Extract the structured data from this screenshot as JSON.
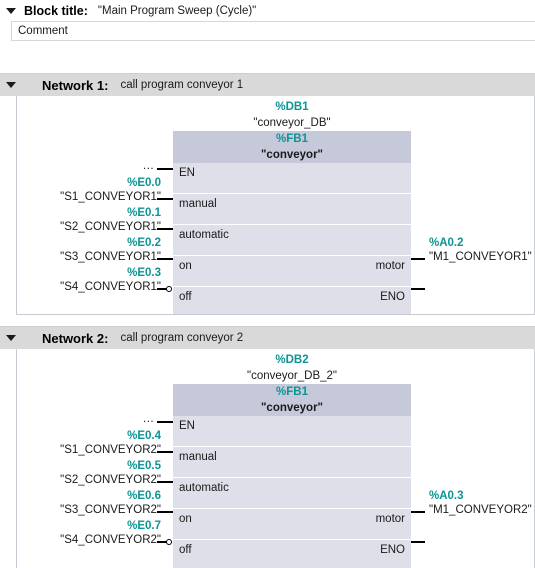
{
  "block": {
    "title_label": "Block title:",
    "title_value": "\"Main Program Sweep (Cycle)\"",
    "comment_text": "Comment",
    "collapse_icon": "triangle-down-icon"
  },
  "colors": {
    "address_teal": "#0d9494",
    "block_header": "#c6c9da",
    "block_body": "#dfdfe9",
    "network_header": "#d9d9d9"
  },
  "networks": [
    {
      "name": "Network 1:",
      "description": "call program conveyor 1",
      "call": {
        "db_number": "%DB1",
        "db_name": "\"conveyor_DB\"",
        "fb_number": "%FB1",
        "fb_name": "\"conveyor\"",
        "en_marker": "...",
        "inputs": [
          {
            "pin": "EN",
            "address": "",
            "operand": "",
            "negated": false
          },
          {
            "pin": "manual",
            "address": "%E0.0",
            "operand": "\"S1_CONVEYOR1\"",
            "negated": false
          },
          {
            "pin": "automatic",
            "address": "%E0.1",
            "operand": "\"S2_CONVEYOR1\"",
            "negated": false
          },
          {
            "pin": "on",
            "address": "%E0.2",
            "operand": "\"S3_CONVEYOR1\"",
            "negated": false
          },
          {
            "pin": "off",
            "address": "%E0.3",
            "operand": "\"S4_CONVEYOR1\"",
            "negated": true
          }
        ],
        "outputs": [
          {
            "pin": "motor",
            "address": "%A0.2",
            "operand": "\"M1_CONVEYOR1\""
          },
          {
            "pin": "ENO",
            "address": "",
            "operand": ""
          }
        ]
      }
    },
    {
      "name": "Network 2:",
      "description": "call program conveyor 2",
      "call": {
        "db_number": "%DB2",
        "db_name": "\"conveyor_DB_2\"",
        "fb_number": "%FB1",
        "fb_name": "\"conveyor\"",
        "en_marker": "...",
        "inputs": [
          {
            "pin": "EN",
            "address": "",
            "operand": "",
            "negated": false
          },
          {
            "pin": "manual",
            "address": "%E0.4",
            "operand": "\"S1_CONVEYOR2\"",
            "negated": false
          },
          {
            "pin": "automatic",
            "address": "%E0.5",
            "operand": "\"S2_CONVEYOR2\"",
            "negated": false
          },
          {
            "pin": "on",
            "address": "%E0.6",
            "operand": "\"S3_CONVEYOR2\"",
            "negated": false
          },
          {
            "pin": "off",
            "address": "%E0.7",
            "operand": "\"S4_CONVEYOR2\"",
            "negated": true
          }
        ],
        "outputs": [
          {
            "pin": "motor",
            "address": "%A0.3",
            "operand": "\"M1_CONVEYOR2\""
          },
          {
            "pin": "ENO",
            "address": "",
            "operand": ""
          }
        ]
      }
    }
  ]
}
